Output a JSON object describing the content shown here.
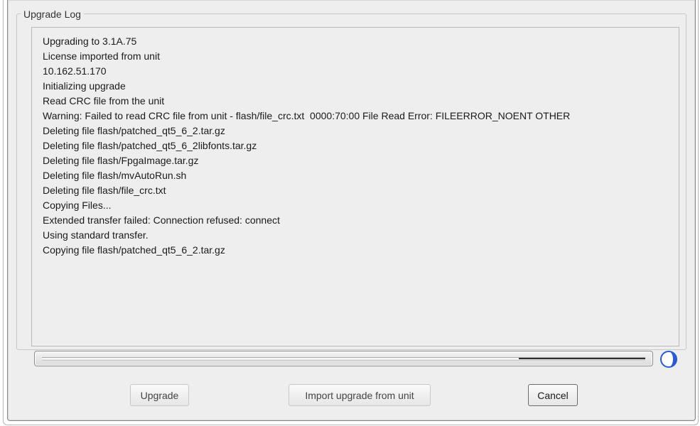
{
  "window": {
    "group_title": "Upgrade Log"
  },
  "log": {
    "lines": [
      "Upgrading to 3.1A.75",
      "License imported from unit",
      "10.162.51.170",
      "Initializing upgrade",
      "Read CRC file from the unit",
      "Warning: Failed to read CRC file from unit - flash/file_crc.txt  0000:70:00 File Read Error: FILEERROR_NOENT OTHER",
      "Deleting file flash/patched_qt5_6_2.tar.gz",
      "Deleting file flash/patched_qt5_6_2libfonts.tar.gz",
      "Deleting file flash/FpgaImage.tar.gz",
      "Deleting file flash/mvAutoRun.sh",
      "Deleting file flash/file_crc.txt",
      "Copying Files...",
      "Extended transfer failed: Connection refused: connect",
      "Using standard transfer.",
      "Copying file flash/patched_qt5_6_2.tar.gz"
    ]
  },
  "progress": {
    "fraction_indicator": 0.21,
    "busy_icon": "half-moon-spinner-icon",
    "accent_color": "#2a5bd7"
  },
  "buttons": {
    "upgrade": "Upgrade",
    "import": "Import upgrade from unit",
    "cancel": "Cancel"
  }
}
